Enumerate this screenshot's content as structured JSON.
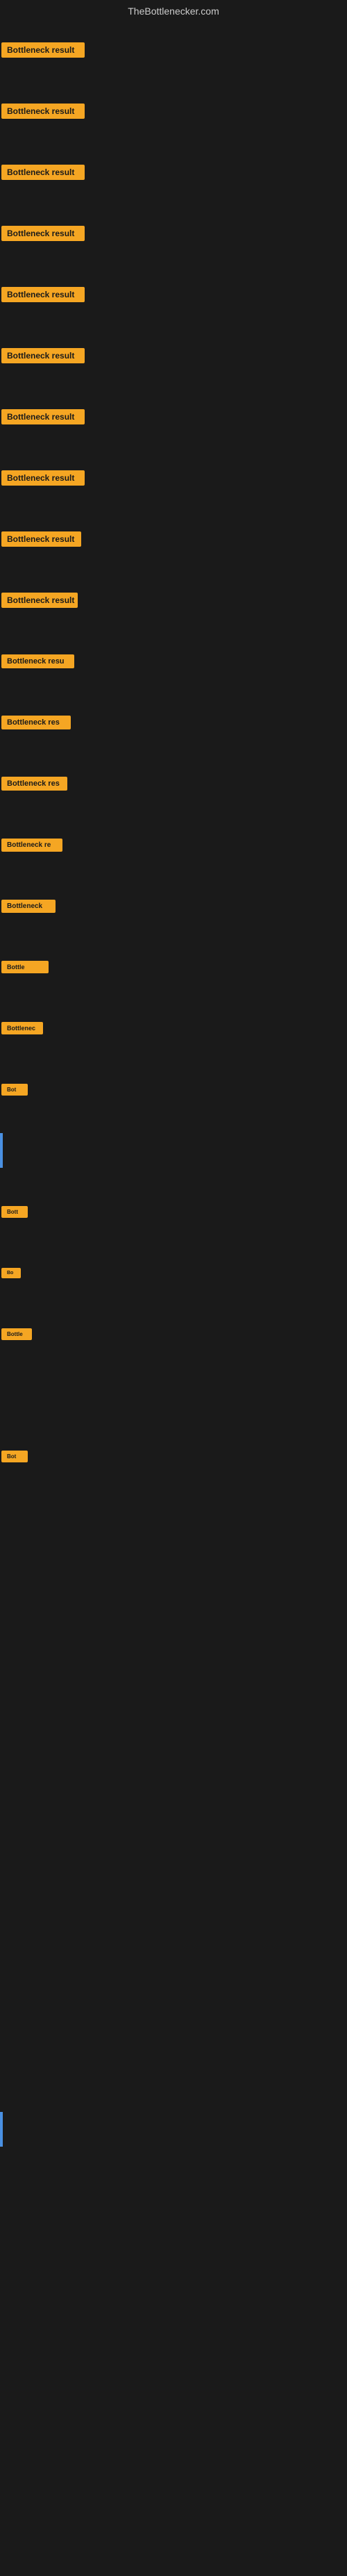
{
  "header": {
    "site_title": "TheBottlenecker.com"
  },
  "rows": [
    {
      "id": 1,
      "label": "Bottleneck result",
      "visible": true
    },
    {
      "id": 2,
      "label": "Bottleneck result",
      "visible": true
    },
    {
      "id": 3,
      "label": "Bottleneck result",
      "visible": true
    },
    {
      "id": 4,
      "label": "Bottleneck result",
      "visible": true
    },
    {
      "id": 5,
      "label": "Bottleneck result",
      "visible": true
    },
    {
      "id": 6,
      "label": "Bottleneck result",
      "visible": true
    },
    {
      "id": 7,
      "label": "Bottleneck result",
      "visible": true
    },
    {
      "id": 8,
      "label": "Bottleneck result",
      "visible": true
    },
    {
      "id": 9,
      "label": "Bottleneck result",
      "visible": true
    },
    {
      "id": 10,
      "label": "Bottleneck result",
      "visible": true
    },
    {
      "id": 11,
      "label": "Bottleneck resu",
      "visible": true
    },
    {
      "id": 12,
      "label": "Bottleneck res",
      "visible": true
    },
    {
      "id": 13,
      "label": "Bottleneck res",
      "visible": true
    },
    {
      "id": 14,
      "label": "Bottleneck re",
      "visible": true
    },
    {
      "id": 15,
      "label": "Bottleneck",
      "visible": true
    },
    {
      "id": 16,
      "label": "Bottle",
      "visible": true
    },
    {
      "id": 17,
      "label": "Bottlenec",
      "visible": true
    },
    {
      "id": 18,
      "label": "Bot",
      "visible": true
    },
    {
      "id": 19,
      "label": "|",
      "visible": true
    },
    {
      "id": 20,
      "label": "Bott",
      "visible": true
    },
    {
      "id": 21,
      "label": "Bo",
      "visible": true
    },
    {
      "id": 22,
      "label": "Bottle",
      "visible": true
    },
    {
      "id": 23,
      "label": "",
      "visible": false
    },
    {
      "id": 24,
      "label": "Bot",
      "visible": true
    }
  ],
  "empty_rows": 15,
  "bottom_cursor_visible": true,
  "accent_color": "#f5a623",
  "bg_color": "#1a1a1a",
  "cursor_color": "#4a90e2"
}
